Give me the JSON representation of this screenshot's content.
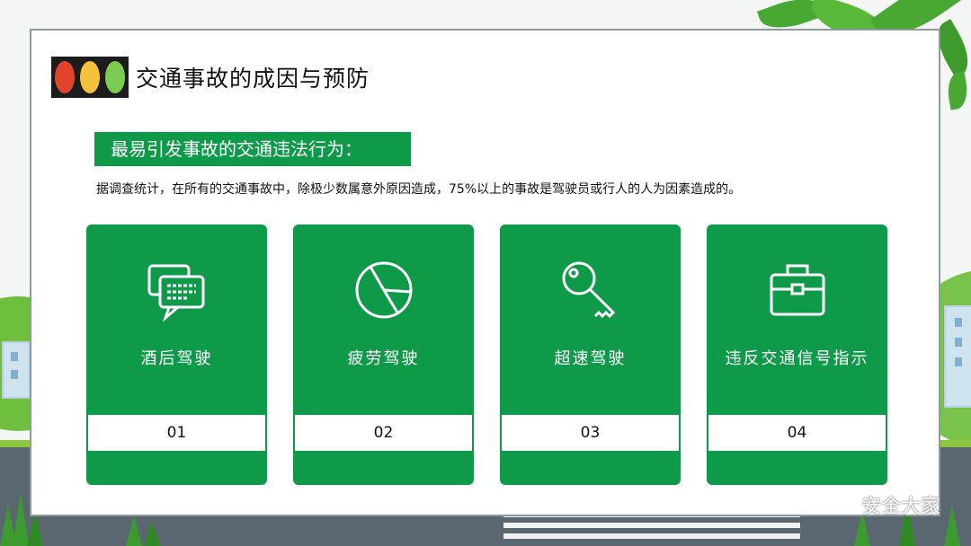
{
  "header": {
    "title": "交通事故的成因与预防"
  },
  "section": {
    "banner": "最易引发事故的交通违法行为：",
    "intro": "据调查统计，在所有的交通事故中，除极少数属意外原因造成，75%以上的事故是驾驶员或行人的人为因素造成的。"
  },
  "tiles": [
    {
      "icon": "chat-bubbles-icon",
      "label": "酒后驾驶",
      "number": "01"
    },
    {
      "icon": "pie-chart-icon",
      "label": "疲劳驾驶",
      "number": "02"
    },
    {
      "icon": "key-icon",
      "label": "超速驾驶",
      "number": "03"
    },
    {
      "icon": "briefcase-icon",
      "label": "违反交通信号指示",
      "number": "04"
    }
  ],
  "watermark": "安全大家",
  "colors": {
    "accent": "#0e9a49",
    "light_red": "#e2432b",
    "light_yellow": "#f5c23a",
    "light_green": "#7ccc52"
  }
}
